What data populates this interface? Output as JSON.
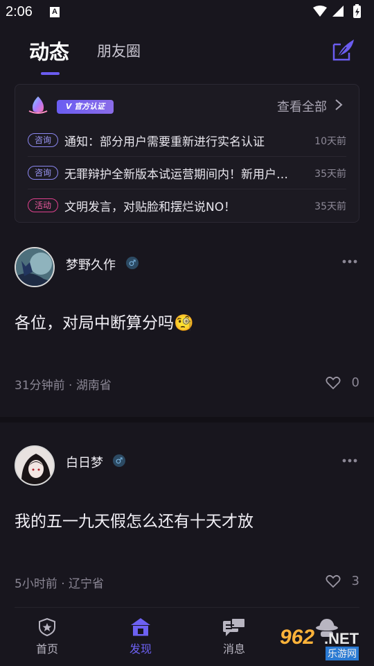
{
  "status_bar": {
    "time": "2:06",
    "notification_icon": "A"
  },
  "header": {
    "tabs": [
      {
        "label": "动态",
        "active": true
      },
      {
        "label": "朋友圈",
        "active": false
      }
    ],
    "compose_icon": "feather-pen-icon"
  },
  "notice_board": {
    "badge": "V 官方认证",
    "view_all": "查看全部",
    "items": [
      {
        "tag": "咨询",
        "title": "通知：部分用户需要重新进行实名认证",
        "time": "10天前",
        "tag_color": "#9a96f4"
      },
      {
        "tag": "咨询",
        "title": "无罪辩护全新版本试运营期间内！新用户…",
        "time": "35天前",
        "tag_color": "#9a96f4"
      },
      {
        "tag": "活动",
        "title": "文明发言，对贴脸和摆烂说NO！",
        "time": "35天前",
        "tag_color": "#ea5a9e"
      }
    ]
  },
  "posts": [
    {
      "author": "梦野久作",
      "gender": "♂",
      "content": "各位，对局中断算分吗🧐",
      "meta": "31分钟前 · 湖南省",
      "likes": "0"
    },
    {
      "author": "白日梦",
      "gender": "♂",
      "content": "我的五一九天假怎么还有十天才放",
      "meta": "5小时前 · 辽宁省",
      "likes": "3"
    }
  ],
  "bottom_nav": [
    {
      "label": "首页",
      "icon": "shield-star-icon",
      "active": false
    },
    {
      "label": "发现",
      "icon": "house-icon",
      "active": true
    },
    {
      "label": "消息",
      "icon": "chat-bubbles-icon",
      "active": false
    },
    {
      "label": "",
      "icon": "detective-hat-icon",
      "active": false
    }
  ],
  "watermark": {
    "brand_number": "962",
    "brand_suffix": ".NET",
    "site_name": "乐游网"
  },
  "colors": {
    "accent": "#6b5cf0",
    "background": "#18161e",
    "activity_tag": "#e0418d"
  }
}
